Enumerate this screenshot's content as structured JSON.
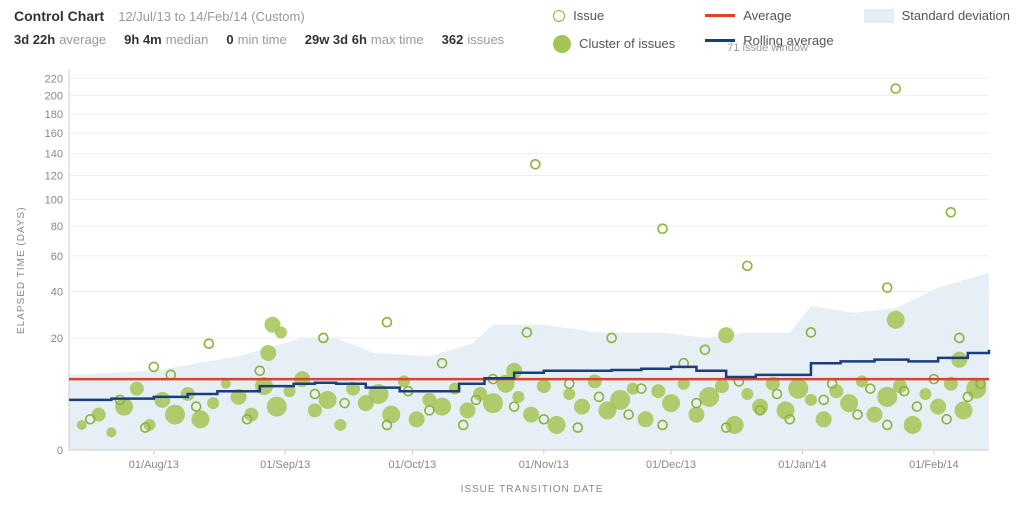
{
  "header": {
    "title": "Control Chart",
    "date_range": "12/Jul/13 to 14/Feb/14 (Custom)",
    "stats": [
      {
        "value": "3d 22h",
        "label": "average"
      },
      {
        "value": "9h 4m",
        "label": "median"
      },
      {
        "value": "0",
        "label": "min time"
      },
      {
        "value": "29w 3d 6h",
        "label": "max time"
      },
      {
        "value": "362",
        "label": "issues"
      }
    ]
  },
  "legend": {
    "issue": "Issue",
    "cluster": "Cluster of issues",
    "average": "Average",
    "rolling": "Rolling average",
    "rolling_sub": "71 issue window",
    "stddev": "Standard deviation"
  },
  "chart_data": {
    "type": "scatter",
    "title": "Control Chart",
    "xlabel": "ISSUE TRANSITION DATE",
    "ylabel": "ELAPSED TIME (DAYS)",
    "x_ticks": [
      "01/Aug/13",
      "01/Sep/13",
      "01/Oct/13",
      "01/Nov/13",
      "01/Dec/13",
      "01/Jan/14",
      "01/Feb/14"
    ],
    "y_ticks": [
      0,
      20,
      40,
      60,
      80,
      100,
      120,
      140,
      160,
      180,
      200,
      220
    ],
    "ylim": [
      0,
      230
    ],
    "xlim": [
      0,
      217
    ],
    "average_line": 8,
    "rolling_average": [
      {
        "x": 0,
        "y": 4
      },
      {
        "x": 10,
        "y": 4.2
      },
      {
        "x": 20,
        "y": 4.5
      },
      {
        "x": 28,
        "y": 5
      },
      {
        "x": 35,
        "y": 5.5
      },
      {
        "x": 45,
        "y": 6.5
      },
      {
        "x": 53,
        "y": 7
      },
      {
        "x": 58,
        "y": 7.2
      },
      {
        "x": 63,
        "y": 7
      },
      {
        "x": 70,
        "y": 6.2
      },
      {
        "x": 78,
        "y": 5.5
      },
      {
        "x": 85,
        "y": 5.5
      },
      {
        "x": 92,
        "y": 7
      },
      {
        "x": 98,
        "y": 8.2
      },
      {
        "x": 105,
        "y": 9.5
      },
      {
        "x": 112,
        "y": 10
      },
      {
        "x": 120,
        "y": 10
      },
      {
        "x": 128,
        "y": 10.2
      },
      {
        "x": 135,
        "y": 10.5
      },
      {
        "x": 142,
        "y": 11
      },
      {
        "x": 148,
        "y": 10
      },
      {
        "x": 155,
        "y": 8.5
      },
      {
        "x": 162,
        "y": 9
      },
      {
        "x": 170,
        "y": 9
      },
      {
        "x": 175,
        "y": 12
      },
      {
        "x": 182,
        "y": 12.5
      },
      {
        "x": 190,
        "y": 13
      },
      {
        "x": 198,
        "y": 12.5
      },
      {
        "x": 205,
        "y": 13.5
      },
      {
        "x": 212,
        "y": 15
      },
      {
        "x": 217,
        "y": 16
      }
    ],
    "std_upper": [
      {
        "x": 0,
        "y": 9
      },
      {
        "x": 20,
        "y": 10
      },
      {
        "x": 40,
        "y": 14
      },
      {
        "x": 55,
        "y": 20
      },
      {
        "x": 63,
        "y": 20
      },
      {
        "x": 72,
        "y": 15
      },
      {
        "x": 85,
        "y": 14
      },
      {
        "x": 95,
        "y": 18
      },
      {
        "x": 100,
        "y": 25
      },
      {
        "x": 112,
        "y": 25
      },
      {
        "x": 125,
        "y": 22
      },
      {
        "x": 140,
        "y": 22
      },
      {
        "x": 150,
        "y": 20
      },
      {
        "x": 160,
        "y": 22
      },
      {
        "x": 170,
        "y": 22
      },
      {
        "x": 175,
        "y": 33
      },
      {
        "x": 185,
        "y": 30
      },
      {
        "x": 195,
        "y": 32
      },
      {
        "x": 205,
        "y": 42
      },
      {
        "x": 217,
        "y": 50
      }
    ],
    "issues": [
      {
        "x": 3,
        "y": 1,
        "r": 5
      },
      {
        "x": 7,
        "y": 2,
        "r": 7
      },
      {
        "x": 10,
        "y": 0.5,
        "r": 5
      },
      {
        "x": 13,
        "y": 3,
        "r": 9
      },
      {
        "x": 16,
        "y": 6,
        "r": 7
      },
      {
        "x": 19,
        "y": 1,
        "r": 6
      },
      {
        "x": 22,
        "y": 4,
        "r": 8
      },
      {
        "x": 25,
        "y": 2,
        "r": 10
      },
      {
        "x": 28,
        "y": 5,
        "r": 7
      },
      {
        "x": 31,
        "y": 1.5,
        "r": 9
      },
      {
        "x": 34,
        "y": 3.5,
        "r": 6
      },
      {
        "x": 37,
        "y": 7,
        "r": 5
      },
      {
        "x": 40,
        "y": 4.5,
        "r": 8
      },
      {
        "x": 43,
        "y": 2,
        "r": 7
      },
      {
        "x": 46,
        "y": 6.5,
        "r": 9
      },
      {
        "x": 49,
        "y": 3,
        "r": 10
      },
      {
        "x": 52,
        "y": 5.5,
        "r": 6
      },
      {
        "x": 55,
        "y": 8,
        "r": 8
      },
      {
        "x": 58,
        "y": 2.5,
        "r": 7
      },
      {
        "x": 47,
        "y": 15,
        "r": 8
      },
      {
        "x": 50,
        "y": 22,
        "r": 6
      },
      {
        "x": 48,
        "y": 25,
        "r": 8
      },
      {
        "x": 61,
        "y": 4,
        "r": 9
      },
      {
        "x": 64,
        "y": 1,
        "r": 6
      },
      {
        "x": 67,
        "y": 6,
        "r": 7
      },
      {
        "x": 70,
        "y": 3.5,
        "r": 8
      },
      {
        "x": 73,
        "y": 5,
        "r": 10
      },
      {
        "x": 76,
        "y": 2,
        "r": 9
      },
      {
        "x": 79,
        "y": 7.5,
        "r": 6
      },
      {
        "x": 82,
        "y": 1.5,
        "r": 8
      },
      {
        "x": 85,
        "y": 4,
        "r": 7
      },
      {
        "x": 88,
        "y": 3,
        "r": 9
      },
      {
        "x": 91,
        "y": 6,
        "r": 6
      },
      {
        "x": 94,
        "y": 2.5,
        "r": 8
      },
      {
        "x": 97,
        "y": 5,
        "r": 7
      },
      {
        "x": 100,
        "y": 3.5,
        "r": 10
      },
      {
        "x": 103,
        "y": 7,
        "r": 9
      },
      {
        "x": 106,
        "y": 4.5,
        "r": 6
      },
      {
        "x": 109,
        "y": 2,
        "r": 8
      },
      {
        "x": 112,
        "y": 6.5,
        "r": 7
      },
      {
        "x": 115,
        "y": 1,
        "r": 9
      },
      {
        "x": 105,
        "y": 10,
        "r": 8
      },
      {
        "x": 118,
        "y": 5,
        "r": 6
      },
      {
        "x": 121,
        "y": 3,
        "r": 8
      },
      {
        "x": 124,
        "y": 7.5,
        "r": 7
      },
      {
        "x": 127,
        "y": 2.5,
        "r": 9
      },
      {
        "x": 130,
        "y": 4,
        "r": 10
      },
      {
        "x": 133,
        "y": 6,
        "r": 6
      },
      {
        "x": 136,
        "y": 1.5,
        "r": 8
      },
      {
        "x": 139,
        "y": 5.5,
        "r": 7
      },
      {
        "x": 142,
        "y": 3.5,
        "r": 9
      },
      {
        "x": 145,
        "y": 7,
        "r": 6
      },
      {
        "x": 148,
        "y": 2,
        "r": 8
      },
      {
        "x": 151,
        "y": 4.5,
        "r": 10
      },
      {
        "x": 154,
        "y": 6.5,
        "r": 7
      },
      {
        "x": 157,
        "y": 1,
        "r": 9
      },
      {
        "x": 160,
        "y": 5,
        "r": 6
      },
      {
        "x": 163,
        "y": 3,
        "r": 8
      },
      {
        "x": 166,
        "y": 7,
        "r": 7
      },
      {
        "x": 169,
        "y": 2.5,
        "r": 9
      },
      {
        "x": 172,
        "y": 6,
        "r": 10
      },
      {
        "x": 175,
        "y": 4,
        "r": 6
      },
      {
        "x": 178,
        "y": 1.5,
        "r": 8
      },
      {
        "x": 181,
        "y": 5.5,
        "r": 7
      },
      {
        "x": 184,
        "y": 3.5,
        "r": 9
      },
      {
        "x": 187,
        "y": 7.5,
        "r": 6
      },
      {
        "x": 190,
        "y": 2,
        "r": 8
      },
      {
        "x": 193,
        "y": 4.5,
        "r": 10
      },
      {
        "x": 196,
        "y": 6.5,
        "r": 7
      },
      {
        "x": 199,
        "y": 1,
        "r": 9
      },
      {
        "x": 202,
        "y": 5,
        "r": 6
      },
      {
        "x": 205,
        "y": 3,
        "r": 8
      },
      {
        "x": 208,
        "y": 7,
        "r": 7
      },
      {
        "x": 211,
        "y": 2.5,
        "r": 9
      },
      {
        "x": 214,
        "y": 6,
        "r": 10
      },
      {
        "x": 155,
        "y": 21,
        "r": 8
      },
      {
        "x": 195,
        "y": 27,
        "r": 9
      },
      {
        "x": 210,
        "y": 13,
        "r": 8
      }
    ],
    "open_issues": [
      {
        "x": 5,
        "y": 1.5
      },
      {
        "x": 12,
        "y": 4
      },
      {
        "x": 18,
        "y": 0.8
      },
      {
        "x": 24,
        "y": 9
      },
      {
        "x": 20,
        "y": 11
      },
      {
        "x": 30,
        "y": 3
      },
      {
        "x": 33,
        "y": 18
      },
      {
        "x": 42,
        "y": 1.5
      },
      {
        "x": 45,
        "y": 10
      },
      {
        "x": 58,
        "y": 5
      },
      {
        "x": 60,
        "y": 20
      },
      {
        "x": 65,
        "y": 3.5
      },
      {
        "x": 75,
        "y": 1
      },
      {
        "x": 75,
        "y": 26
      },
      {
        "x": 80,
        "y": 5.5
      },
      {
        "x": 85,
        "y": 2.5
      },
      {
        "x": 88,
        "y": 12
      },
      {
        "x": 93,
        "y": 1
      },
      {
        "x": 96,
        "y": 4
      },
      {
        "x": 100,
        "y": 8
      },
      {
        "x": 105,
        "y": 3
      },
      {
        "x": 108,
        "y": 22
      },
      {
        "x": 110,
        "y": 130
      },
      {
        "x": 112,
        "y": 1.5
      },
      {
        "x": 118,
        "y": 7
      },
      {
        "x": 120,
        "y": 0.8
      },
      {
        "x": 125,
        "y": 4.5
      },
      {
        "x": 128,
        "y": 20
      },
      {
        "x": 132,
        "y": 2
      },
      {
        "x": 135,
        "y": 6
      },
      {
        "x": 140,
        "y": 1
      },
      {
        "x": 140,
        "y": 78
      },
      {
        "x": 145,
        "y": 12
      },
      {
        "x": 148,
        "y": 3.5
      },
      {
        "x": 150,
        "y": 16
      },
      {
        "x": 155,
        "y": 0.8
      },
      {
        "x": 158,
        "y": 7.5
      },
      {
        "x": 160,
        "y": 54
      },
      {
        "x": 163,
        "y": 2.5
      },
      {
        "x": 167,
        "y": 5
      },
      {
        "x": 170,
        "y": 1.5
      },
      {
        "x": 175,
        "y": 22
      },
      {
        "x": 178,
        "y": 4
      },
      {
        "x": 180,
        "y": 7
      },
      {
        "x": 186,
        "y": 2
      },
      {
        "x": 189,
        "y": 6
      },
      {
        "x": 193,
        "y": 42
      },
      {
        "x": 195,
        "y": 208
      },
      {
        "x": 193,
        "y": 1
      },
      {
        "x": 197,
        "y": 5.5
      },
      {
        "x": 200,
        "y": 3
      },
      {
        "x": 204,
        "y": 8
      },
      {
        "x": 207,
        "y": 1.5
      },
      {
        "x": 208,
        "y": 90
      },
      {
        "x": 210,
        "y": 20
      },
      {
        "x": 212,
        "y": 4.5
      },
      {
        "x": 215,
        "y": 7
      }
    ]
  }
}
